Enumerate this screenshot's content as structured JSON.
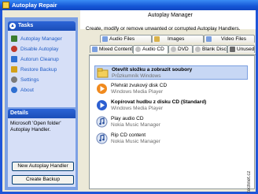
{
  "window": {
    "title": "Autoplay Repair"
  },
  "left": {
    "tasks_header": "Tasks",
    "tasks": [
      {
        "label": "Autoplay Manager",
        "icon": "autoplay-manager-icon",
        "color": "#3b7d2e"
      },
      {
        "label": "Disable Autoplay",
        "icon": "disable-autoplay-icon",
        "color": "#c0392b"
      },
      {
        "label": "Autorun Cleanup",
        "icon": "autorun-cleanup-icon",
        "color": "#2e6fd1"
      },
      {
        "label": "Restore Backup",
        "icon": "restore-backup-icon",
        "color": "#d4a017"
      },
      {
        "label": "Settings",
        "icon": "settings-icon",
        "color": "#7a7a7a"
      },
      {
        "label": "About",
        "icon": "about-icon",
        "color": "#2e6fd1"
      }
    ],
    "details_header": "Details",
    "details_text": "Microsoft 'Open folder' Autoplay Handler.",
    "new_button": "New Autoplay Handler",
    "backup_button": "Create Backup"
  },
  "right": {
    "title": "Autoplay Manager",
    "description": "Create, modify or remove unwanted or corrupted Autoplay Handlers.",
    "tabs_row1": [
      "Audio Files",
      "Images",
      "Video Files"
    ],
    "tabs_row2": [
      "Mixed Content",
      "Audio CD",
      "DVD",
      "Blank Disc",
      "Unused"
    ],
    "active_tab": "Audio CD",
    "items": [
      {
        "title": "Otevřít složku a zobrazit soubory",
        "subtitle": "Průzkumník Windows",
        "icon": "folder-icon"
      },
      {
        "title": "Přehrát zvukový disk CD",
        "subtitle": "Windows Media Player",
        "icon": "media-player-icon"
      },
      {
        "title": "Kopírovat hudbu z disku CD (Standard)",
        "subtitle": "Windows Media Player",
        "icon": "media-player-icon"
      },
      {
        "title": "Play audio CD",
        "subtitle": "Nokia Music Manager",
        "icon": "music-note-icon"
      },
      {
        "title": "Rip CD content",
        "subtitle": "Nokia Music Manager",
        "icon": "music-note-icon"
      }
    ]
  },
  "watermark": "technet.cz",
  "colors": {
    "titlebar": "#1556d6",
    "pane": "#7ca0e4",
    "selection": "#c7d7f4",
    "link": "#215dc6"
  }
}
